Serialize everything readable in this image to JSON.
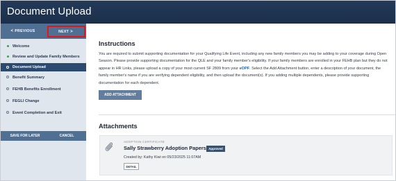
{
  "header": {
    "title": "Document Upload"
  },
  "nav": {
    "previous_label": "PREVIOUS",
    "next_label": "NEXT"
  },
  "sidebar": {
    "items": [
      {
        "label": "Welcome",
        "state": "complete"
      },
      {
        "label": "Review and Update Family Members",
        "state": "complete"
      },
      {
        "label": "Document Upload",
        "state": "active"
      },
      {
        "label": "Benefit Summary",
        "state": "pending"
      },
      {
        "label": "FEHB Benefits Enrollment",
        "state": "pending"
      },
      {
        "label": "FEGLI Change",
        "state": "pending"
      },
      {
        "label": "Event Completion and Exit",
        "state": "pending"
      }
    ],
    "save_later_label": "SAVE FOR LATER",
    "cancel_label": "CANCEL"
  },
  "main": {
    "instructions_heading": "Instructions",
    "instructions_text": "You are required to submit supporting documentation for your Qualifying Life Event, including any new family members you may be adding to your coverage during Open Season. Please provide supporting documentation for the QLE and your family member's eligibility. If your family members are enrolled in your FEHB plan but they do not appear in HR Links, please upload a copy of your most current SF 2809 from your ",
    "instructions_link": "eOPF",
    "instructions_text_2": ". Select the Add Attachment button, enter a description of your document, the family member's name if you are verifying dependent eligibility, and then upload the document(s). If you adding multiple dependents, please provide supporting documentation for each dependent.",
    "add_attachment_label": "ADD ATTACHMENT",
    "attachments_heading": "Attachments",
    "attachment": {
      "category": "ADOPTION CERTIFICATE",
      "name": "Sally Strawberry Adoption Papers",
      "status": "Approved",
      "created": "Created by: Kathy Kiwi on 05/23/2025 11:07AM",
      "detail_label": "DETAIL"
    }
  },
  "icons": {
    "prev": "chevron-left-icon",
    "next": "chevron-right-icon",
    "attachment": "paperclip-icon"
  },
  "colors": {
    "header": "#1b2f4a",
    "accent": "#4f6f93",
    "active_item": "#2c4a70",
    "complete_dot": "#3d9b56",
    "highlight": "#e0161b"
  }
}
